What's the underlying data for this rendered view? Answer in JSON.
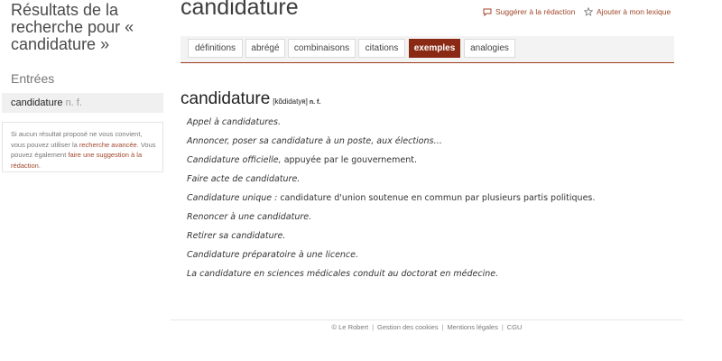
{
  "sidebar": {
    "results_title": "Résultats de la recherche pour « candidature »",
    "entries_label": "Entrées",
    "entry": {
      "word": "candidature",
      "pos": "n. f."
    },
    "help": {
      "text1": "Si aucun résultat proposé ne vous convient, vous pouvez utiliser la ",
      "link1": "recherche avancée",
      "text2": ". Vous pouvez également ",
      "link2": "faire une suggestion à la rédaction",
      "text3": "."
    }
  },
  "header": {
    "headword": "candidature",
    "suggest_label": "Suggérer à la rédaction",
    "lexicon_label": "Ajouter à mon lexique",
    "suggest_icon": "comment-icon",
    "lexicon_icon": "star-icon"
  },
  "tabs": [
    {
      "label": "définitions",
      "active": false
    },
    {
      "label": "abrégé",
      "active": false
    },
    {
      "label": "combinaisons",
      "active": false
    },
    {
      "label": "citations",
      "active": false
    },
    {
      "label": "exemples",
      "active": true
    },
    {
      "label": "analogies",
      "active": false
    }
  ],
  "entry": {
    "word": "candidature",
    "phonetic": "[kɑ̃didatyʀ]",
    "pos": "n. f."
  },
  "examples": [
    {
      "italic": "Appel à candidatures.",
      "plain": ""
    },
    {
      "italic": "Annoncer, poser sa candidature à un poste, aux élections…",
      "plain": ""
    },
    {
      "italic": "Candidature officielle,",
      "plain": " appuyée par le gouvernement."
    },
    {
      "italic": "Faire acte de candidature.",
      "plain": ""
    },
    {
      "italic": "Candidature unique :",
      "plain": " candidature d'union soutenue en commun par plusieurs partis politiques."
    },
    {
      "italic": "Renoncer à une candidature.",
      "plain": ""
    },
    {
      "italic": "Retirer sa candidature.",
      "plain": ""
    },
    {
      "italic": "Candidature préparatoire à une licence.",
      "plain": ""
    },
    {
      "italic": "La candidature en sciences médicales conduit au doctorat en médecine.",
      "plain": ""
    }
  ],
  "footer": {
    "copyright": "© Le Robert",
    "links": [
      "Gestion des cookies",
      "Mentions légales",
      "CGU"
    ]
  },
  "colors": {
    "accent": "#8a2a14",
    "link": "#a0472a"
  }
}
